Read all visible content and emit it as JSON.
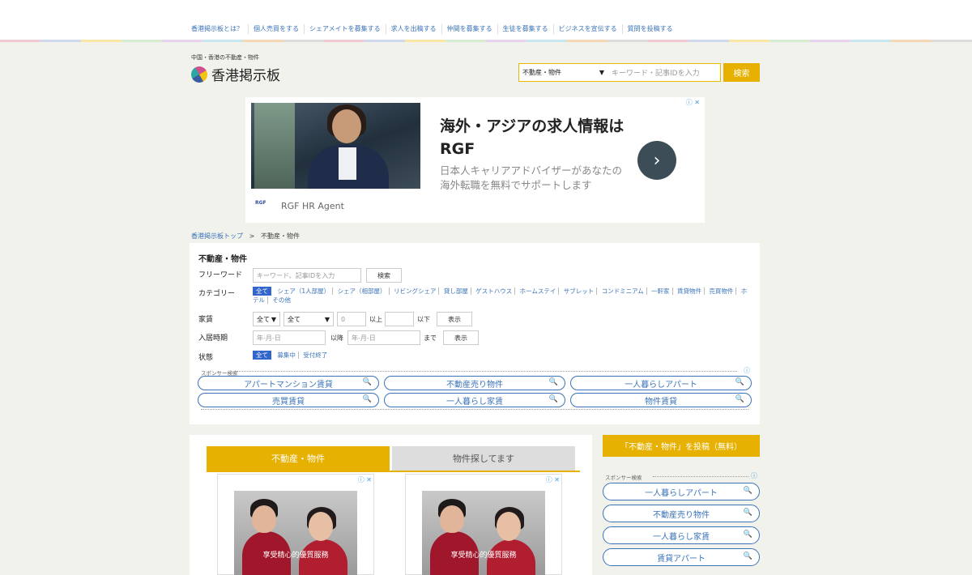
{
  "nav": {
    "items": [
      "香港掲示板とは？",
      "個人売買をする",
      "シェアメイトを募集する",
      "求人を出稿する",
      "仲間を募集する",
      "生徒を募集する",
      "ビジネスを宣伝する",
      "質問を投稿する"
    ]
  },
  "stripe_colors": [
    "#f4c9d6",
    "#cdd9ef",
    "#fbe7a4",
    "#d6edd4",
    "#e8d4ee",
    "#c8e6ef",
    "#f6d7b8",
    "#dcdcdc"
  ],
  "header": {
    "logo_sub": "中国・香港の不動産・物件",
    "logo_text": "香港掲示板",
    "search_select": "不動産・物件",
    "search_placeholder": "キーワード・記事IDを入力",
    "search_button": "検索"
  },
  "ad": {
    "title": "海外・アジアの求人情報はRGF",
    "description": "日本人キャリアアドバイザーがあなたの海外転職を無料でサポートします",
    "brand": "RGF HR Agent",
    "brand_logo": "RGF",
    "info": "ⓘ ✕"
  },
  "breadcrumb": {
    "home": "香港掲示板トップ",
    "separator": ">",
    "current": "不動産・物件"
  },
  "filter": {
    "title": "不動産・物件",
    "freeword_label": "フリーワード",
    "freeword_placeholder": "キーワード、記事IDを入力",
    "search_button": "検索",
    "category_label": "カテゴリー",
    "categories": [
      "全て",
      "シェア（1人部屋）",
      "シェア（相部屋）",
      "リビングシェア",
      "貸し部屋",
      "ゲストハウス",
      "ホームステイ",
      "サブレット",
      "コンドミニアム",
      "一軒家",
      "賃貸物件",
      "売買物件",
      "ホテル",
      "その他"
    ],
    "rent_label": "家賃",
    "rent_select1": "全て",
    "rent_select2": "全て",
    "rent_min": "0",
    "rent_min_suffix": "以上",
    "rent_max_suffix": "以下",
    "show_button": "表示",
    "move_label": "入居時期",
    "date_placeholder": "年-月-日",
    "after_label": "以降",
    "until_label": "まで",
    "state_label": "状態",
    "states": [
      "全て",
      "募集中",
      "受付終了"
    ],
    "sponsor_label": "スポンサー検索",
    "sponsor_info": "ⓘ",
    "sponsor_pills": [
      "アパートマンション賃貸",
      "不動産売り物件",
      "一人暮らしアパート",
      "売買賃貸",
      "一人暮らし家賃",
      "物件賃貸"
    ]
  },
  "listing": {
    "tab1": "不動産・物件",
    "tab2": "物件探してます",
    "card_caption": "享受精心的優質服務",
    "card_info": "ⓘ ✕"
  },
  "sidebar": {
    "post_button": "「不動産・物件」を投稿（無料）",
    "sponsor_label": "スポンサー検索",
    "sponsor_info": "ⓘ",
    "pills": [
      "一人暮らしアパート",
      "不動産売り物件",
      "一人暮らし家賃",
      "賃貸アパート"
    ]
  },
  "icons": {
    "search": "🔍",
    "dropdown": "▼",
    "arrow": "›"
  },
  "colors": {
    "accent": "#e6b100",
    "link": "#3b73b9",
    "selected": "#3366cc"
  }
}
